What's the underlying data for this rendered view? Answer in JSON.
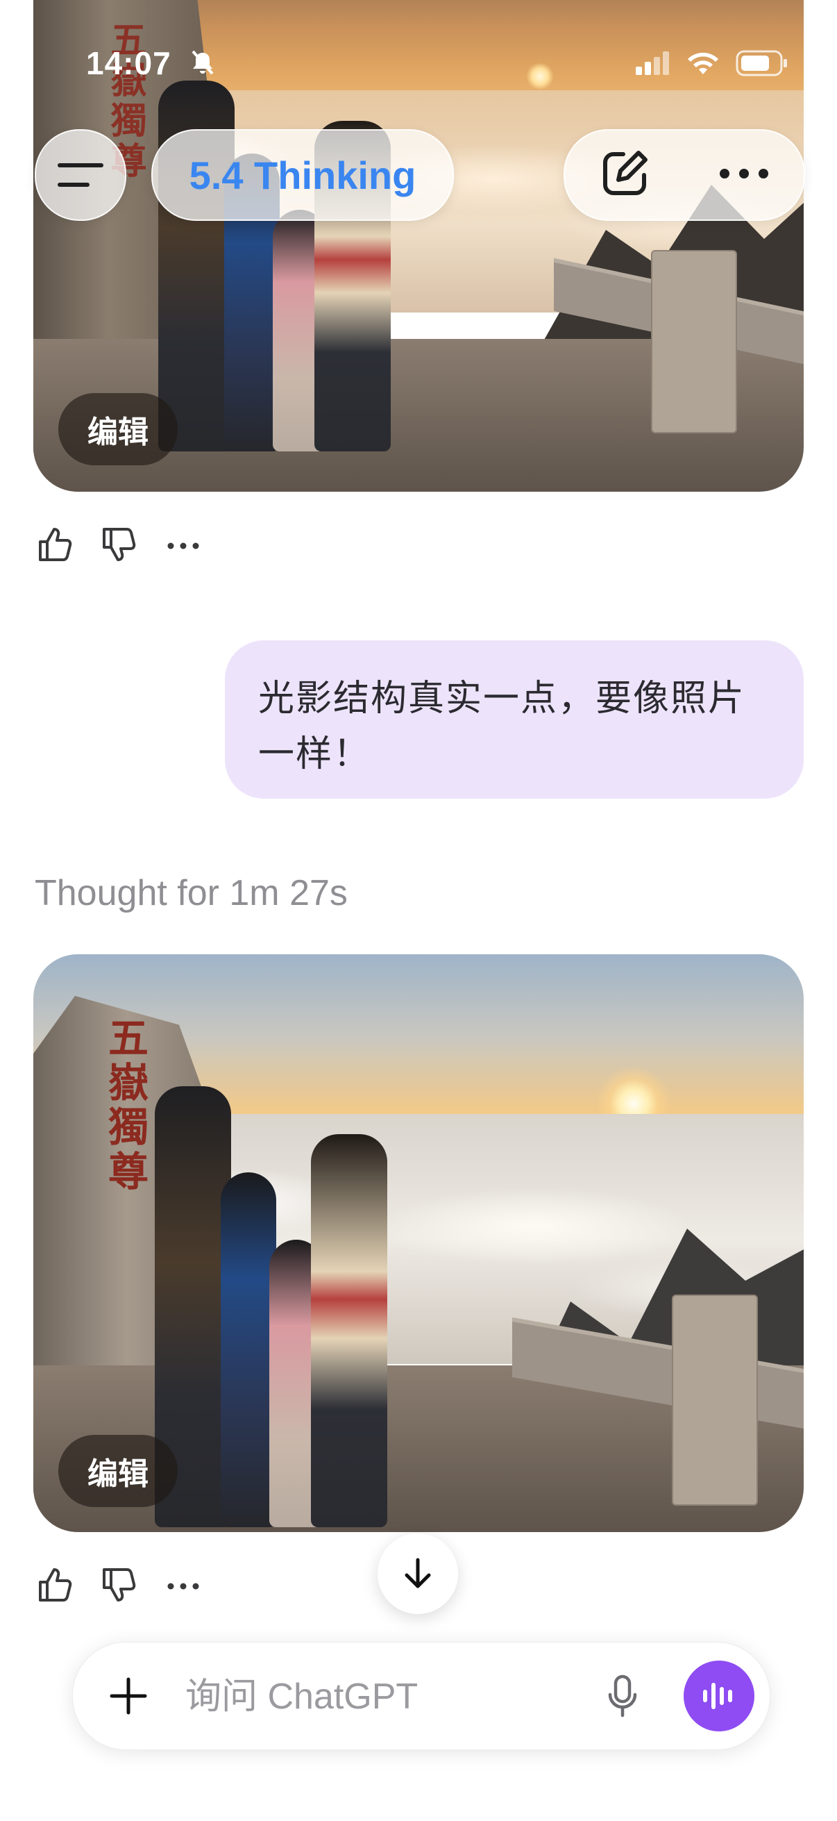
{
  "status_bar": {
    "time": "14:07"
  },
  "header": {
    "model_label": "5.4 Thinking"
  },
  "images": [
    {
      "edit_label": "编辑",
      "carving": "五嶽獨尊"
    },
    {
      "edit_label": "编辑",
      "carving": "五嶽獨尊"
    }
  ],
  "user_message": {
    "text": "光影结构真实一点，要像照片一样！"
  },
  "thought": {
    "label": "Thought for 1m 27s"
  },
  "composer": {
    "placeholder": "询问 ChatGPT"
  },
  "colors": {
    "accent_model": "#3a86f0",
    "user_bubble": "#ede4fb",
    "voice_button": "#8e4cf2"
  },
  "icons": [
    "bell-slash-icon",
    "signal-icon",
    "wifi-icon",
    "battery-icon",
    "menu-icon",
    "new-chat-icon",
    "more-icon",
    "thumbs-up-icon",
    "thumbs-down-icon",
    "arrow-down-icon",
    "plus-icon",
    "mic-icon",
    "voice-wave-icon"
  ]
}
